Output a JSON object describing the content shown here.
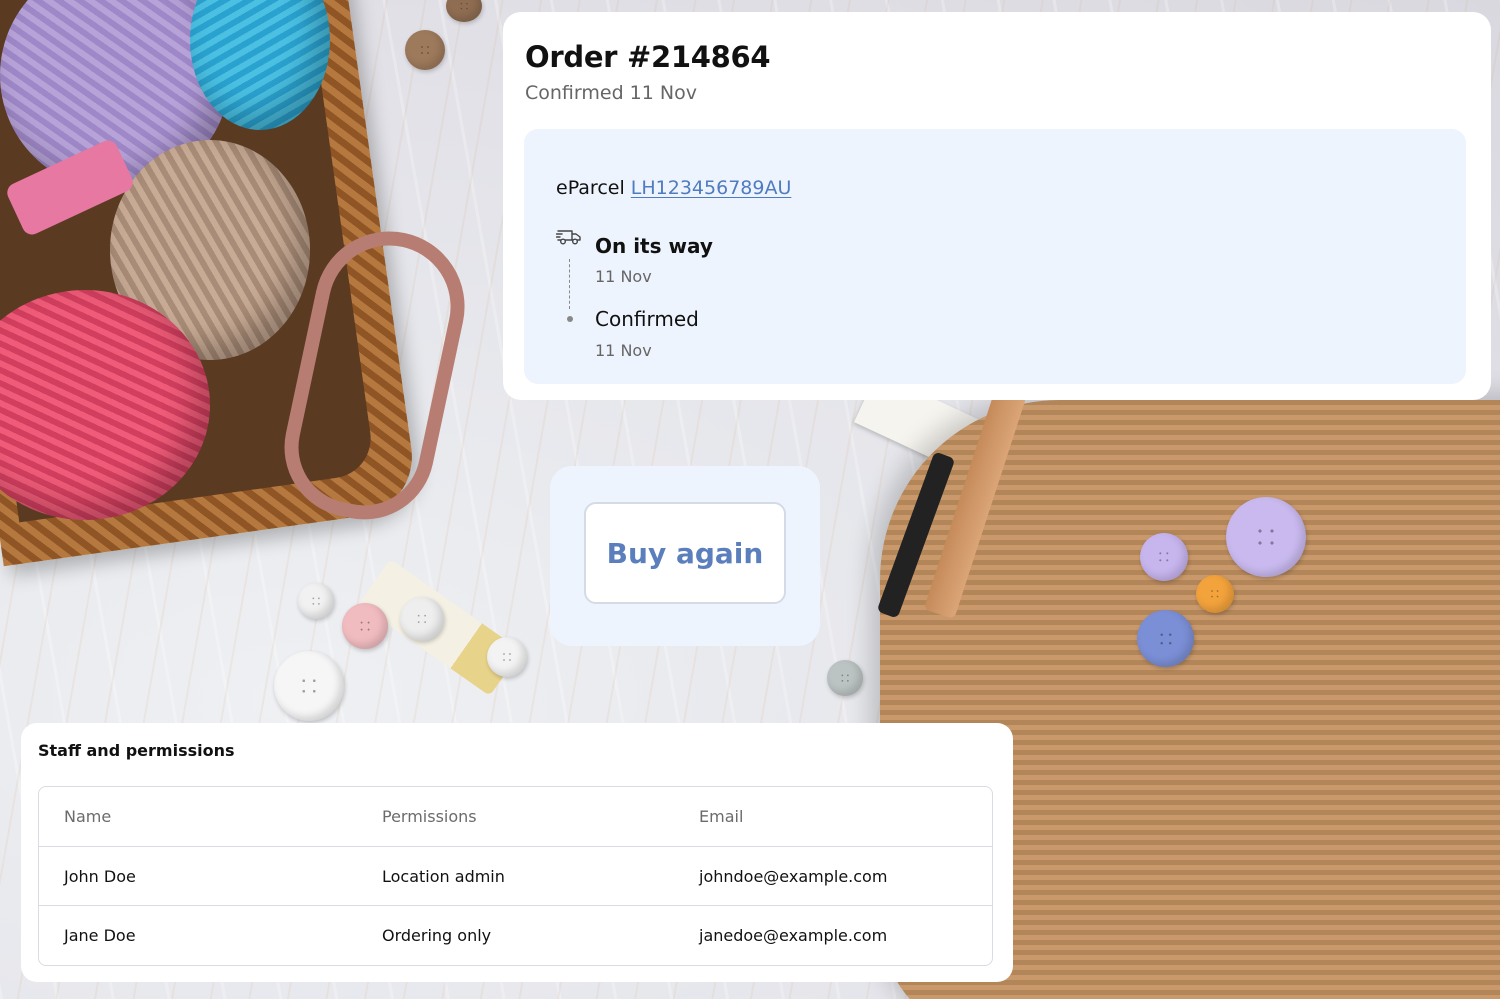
{
  "order": {
    "title": "Order #214864",
    "subtitle": "Confirmed 11 Nov"
  },
  "shipment": {
    "carrier": "eParcel",
    "tracking_number": "LH123456789AU",
    "events": [
      {
        "status": "On its way",
        "date": "11 Nov",
        "icon": "truck-icon"
      },
      {
        "status": "Confirmed",
        "date": "11 Nov",
        "icon": "dot-icon"
      }
    ]
  },
  "actions": {
    "buy_again_label": "Buy again"
  },
  "staff": {
    "title": "Staff and permissions",
    "columns": [
      "Name",
      "Permissions",
      "Email"
    ],
    "rows": [
      [
        "John Doe",
        "Location admin",
        "johndoe@example.com"
      ],
      [
        "Jane Doe",
        "Ordering only",
        "janedoe@example.com"
      ]
    ]
  },
  "colors": {
    "link": "#4f7bc0",
    "shipment_bg": "#eef4fd",
    "button_text": "#5b7fbd"
  }
}
